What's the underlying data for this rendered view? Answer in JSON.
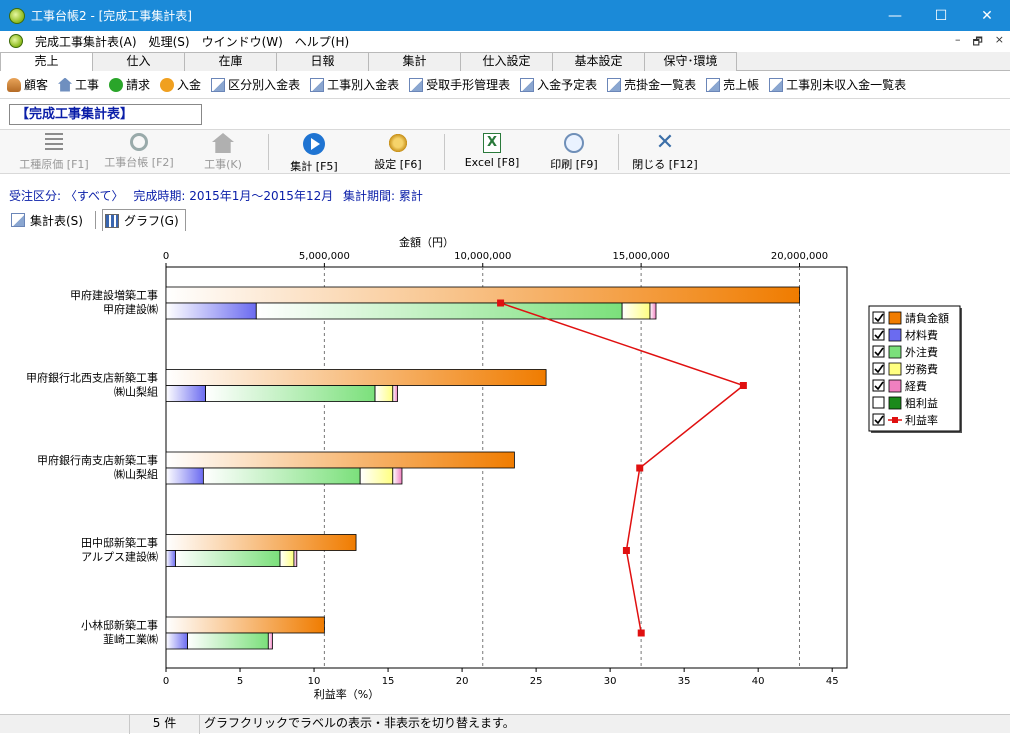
{
  "window": {
    "title": "工事台帳2 - [完成工事集計表]",
    "controls": [
      "—",
      "☐",
      "✕"
    ]
  },
  "menu": {
    "items": [
      "完成工事集計表(A)",
      "処理(S)",
      "ウインドウ(W)",
      "ヘルプ(H)"
    ],
    "mdi_controls": [
      "–",
      "🗗",
      "×"
    ]
  },
  "tabs": [
    "売上",
    "仕入",
    "在庫",
    "日報",
    "集計",
    "仕入設定",
    "基本設定",
    "保守･環境"
  ],
  "shortcuts": [
    {
      "label": "顧客",
      "icon": "customer-icon"
    },
    {
      "label": "工事",
      "icon": "construction-icon"
    },
    {
      "label": "請求",
      "icon": "invoice-icon"
    },
    {
      "label": "入金",
      "icon": "payment-icon"
    },
    {
      "label": "区分別入金表",
      "icon": "document-icon"
    },
    {
      "label": "工事別入金表",
      "icon": "document-icon"
    },
    {
      "label": "受取手形管理表",
      "icon": "document-icon"
    },
    {
      "label": "入金予定表",
      "icon": "document-icon"
    },
    {
      "label": "売掛金一覧表",
      "icon": "document-icon"
    },
    {
      "label": "売上帳",
      "icon": "document-icon"
    },
    {
      "label": "工事別未収入金一覧表",
      "icon": "document-icon"
    }
  ],
  "section_title": "【完成工事集計表】",
  "toolbar": {
    "cost_by_type": "工種原価 [F1]",
    "ledger": "工事台帳 [F2]",
    "construction": "工事(K)",
    "aggregate": "集計 [F5]",
    "settings": "設定 [F6]",
    "excel": "Excel [F8]",
    "print": "印刷 [F9]",
    "close": "閉じる [F12]"
  },
  "filter": {
    "order_type": "受注区分: 〈すべて〉",
    "completion_period": "完成時期:  2015年1月〜2015年12月",
    "aggregation_period": "集計期間:  累計"
  },
  "view_tabs": {
    "table": "集計表(S)",
    "graph": "グラフ(G)"
  },
  "status": {
    "count": "5 件",
    "message": "グラフクリックでラベルの表示・非表示を切り替えます。"
  },
  "chart_data": {
    "type": "bar",
    "orientation": "horizontal",
    "xlabel_top": "金額（円）",
    "xlabel_bottom": "利益率（%）",
    "top_axis": {
      "range": [
        0,
        21500000
      ],
      "ticks": [
        0,
        5000000,
        10000000,
        15000000,
        20000000
      ],
      "tick_labels": [
        "0",
        "5,000,000",
        "10,000,000",
        "15,000,000",
        "20,000,000"
      ]
    },
    "bottom_axis": {
      "range": [
        0,
        46
      ],
      "ticks": [
        0,
        5,
        10,
        15,
        20,
        25,
        30,
        35,
        40,
        45
      ]
    },
    "gridlines": "dashed vertical",
    "legend_position": "right",
    "categories": [
      {
        "project": "甲府建設増築工事",
        "contractor": "甲府建設㈱"
      },
      {
        "project": "甲府銀行北西支店新築工事",
        "contractor": "㈱山梨組"
      },
      {
        "project": "甲府銀行南支店新築工事",
        "contractor": "㈱山梨組"
      },
      {
        "project": "田中邸新築工事",
        "contractor": "アルプス建設㈱"
      },
      {
        "project": "小林邸新築工事",
        "contractor": "韮崎工業㈱"
      }
    ],
    "series": [
      {
        "name": "請負金額",
        "color": "#f07c00",
        "checked": true,
        "values": [
          20000000,
          12000000,
          11000000,
          6000000,
          5000000
        ]
      },
      {
        "name": "材料費",
        "color": "#6b6bf0",
        "checked": true,
        "values": [
          2850000,
          1250000,
          1180000,
          300000,
          680000
        ]
      },
      {
        "name": "外注費",
        "color": "#7be07b",
        "checked": true,
        "values": [
          11550000,
          5350000,
          4950000,
          3300000,
          2550000
        ]
      },
      {
        "name": "労務費",
        "color": "#ffff80",
        "checked": true,
        "values": [
          880000,
          560000,
          1030000,
          440000,
          0
        ]
      },
      {
        "name": "経費",
        "color": "#f080c0",
        "checked": true,
        "values": [
          190000,
          150000,
          290000,
          90000,
          130000
        ]
      },
      {
        "name": "粗利益",
        "color": "#1a8a1a",
        "checked": false,
        "values": []
      },
      {
        "name": "利益率",
        "color": "#e01010",
        "checked": true,
        "values": [
          22.6,
          39.0,
          32.0,
          31.1,
          32.1
        ]
      }
    ]
  }
}
